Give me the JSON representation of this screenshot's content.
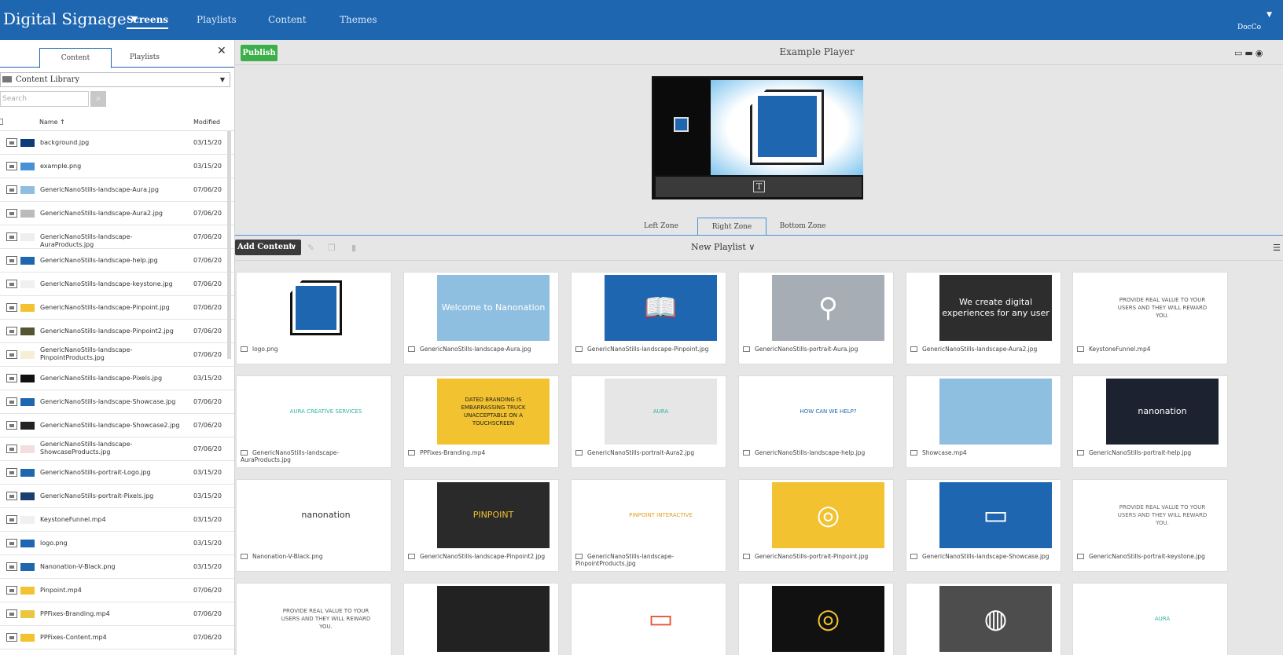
{
  "app": {
    "title": "Digital Signage",
    "user": "DocCo"
  },
  "nav": [
    "Screens",
    "Playlists",
    "Content",
    "Themes"
  ],
  "left": {
    "tabs": [
      "Content",
      "Playlists"
    ],
    "library": "Content Library",
    "search_placeholder": "Search",
    "col_name": "Name ↑",
    "col_modified": "Modified",
    "rows": [
      {
        "name": "background.jpg",
        "date": "03/15/20",
        "color": "#0b3d7a"
      },
      {
        "name": "example.png",
        "date": "03/15/20",
        "color": "#4a90d9"
      },
      {
        "name": "GenericNanoStills-landscape-Aura.jpg",
        "date": "07/06/20",
        "color": "#8fbfe0"
      },
      {
        "name": "GenericNanoStills-landscape-Aura2.jpg",
        "date": "07/06/20",
        "color": "#bbbbbb"
      },
      {
        "name": "GenericNanoStills-landscape-AuraProducts.jpg",
        "date": "07/06/20",
        "color": "#eeeeee"
      },
      {
        "name": "GenericNanoStills-landscape-help.jpg",
        "date": "07/06/20",
        "color": "#1f66b1"
      },
      {
        "name": "GenericNanoStills-landscape-keystone.jpg",
        "date": "07/06/20",
        "color": "#f0f0f0"
      },
      {
        "name": "GenericNanoStills-landscape-Pinpoint.jpg",
        "date": "07/06/20",
        "color": "#f2c230"
      },
      {
        "name": "GenericNanoStills-landscape-Pinpoint2.jpg",
        "date": "07/06/20",
        "color": "#555533"
      },
      {
        "name": "GenericNanoStills-landscape-PinpointProducts.jpg",
        "date": "07/06/20",
        "color": "#f7efd5"
      },
      {
        "name": "GenericNanoStills-landscape-Pixels.jpg",
        "date": "03/15/20",
        "color": "#111111"
      },
      {
        "name": "GenericNanoStills-landscape-Showcase.jpg",
        "date": "07/06/20",
        "color": "#1f66b1"
      },
      {
        "name": "GenericNanoStills-landscape-Showcase2.jpg",
        "date": "07/06/20",
        "color": "#222222"
      },
      {
        "name": "GenericNanoStills-landscape-ShowcaseProducts.jpg",
        "date": "07/06/20",
        "color": "#f3dede"
      },
      {
        "name": "GenericNanoStills-portrait-Logo.jpg",
        "date": "03/15/20",
        "color": "#1f66b1"
      },
      {
        "name": "GenericNanoStills-portrait-Pixels.jpg",
        "date": "03/15/20",
        "color": "#1a3f6f"
      },
      {
        "name": "KeystoneFunnel.mp4",
        "date": "03/15/20",
        "color": "#f0f0f0"
      },
      {
        "name": "logo.png",
        "date": "03/15/20",
        "color": "#1f66b1"
      },
      {
        "name": "Nanonation-V-Black.png",
        "date": "03/15/20",
        "color": "#1f66b1"
      },
      {
        "name": "Pinpoint.mp4",
        "date": "07/06/20",
        "color": "#f2c230"
      },
      {
        "name": "PPFixes-Branding.mp4",
        "date": "07/06/20",
        "color": "#e8c840"
      },
      {
        "name": "PPFixes-Content.mp4",
        "date": "07/06/20",
        "color": "#f2c230"
      }
    ]
  },
  "main": {
    "publish": "Publish",
    "player_title": "Example Player",
    "zones": [
      "Left Zone",
      "Right Zone",
      "Bottom Zone"
    ],
    "add_content": "Add Content",
    "playlist": "New Playlist",
    "cards": [
      {
        "name": "logo.png",
        "kind": "logo"
      },
      {
        "name": "GenericNanoStills-landscape-Aura.jpg",
        "kind": "text",
        "bg": "#8fbfe0",
        "fg": "#ffffff",
        "text": "Welcome to Nanonation"
      },
      {
        "name": "GenericNanoStills-landscape-Pinpoint.jpg",
        "kind": "icon",
        "bg": "#1f66b1",
        "icon": "📖"
      },
      {
        "name": "GenericNanoStills-portrait-Aura.jpg",
        "kind": "icon",
        "bg": "#a6adb4",
        "icon": "⚲"
      },
      {
        "name": "GenericNanoStills-landscape-Aura2.jpg",
        "kind": "text",
        "bg": "#2d2d2d",
        "fg": "#ffffff",
        "text": "We create digital experiences for any user"
      },
      {
        "name": "KeystoneFunnel.mp4",
        "kind": "text",
        "bg": "#ffffff",
        "fg": "#555555",
        "text": "PROVIDE REAL VALUE TO YOUR USERS AND THEY WILL REWARD YOU.",
        "small": true
      },
      {
        "name": "GenericNanoStills-landscape-AuraProducts.jpg",
        "kind": "text",
        "bg": "#ffffff",
        "fg": "#2bb3a3",
        "text": "AURA CREATIVE SERVICES",
        "small": true
      },
      {
        "name": "PPFixes-Branding.mp4",
        "kind": "text",
        "bg": "#f2c230",
        "fg": "#222222",
        "text": "DATED BRANDING IS EMBARRASSING TRUCK UNACCEPTABLE ON A TOUCHSCREEN",
        "small": true
      },
      {
        "name": "GenericNanoStills-portrait-Aura2.jpg",
        "kind": "text",
        "bg": "#e6e6e6",
        "fg": "#2bb3a3",
        "text": "AURA",
        "small": true
      },
      {
        "name": "GenericNanoStills-landscape-help.jpg",
        "kind": "text",
        "bg": "#ffffff",
        "fg": "#1f66b1",
        "text": "HOW CAN WE HELP?",
        "small": true
      },
      {
        "name": "Showcase.mp4",
        "kind": "text",
        "bg": "#8fbfe0",
        "fg": "#8fbfe0",
        "text": ""
      },
      {
        "name": "GenericNanoStills-portrait-help.jpg",
        "kind": "text",
        "bg": "#1c2230",
        "fg": "#ffffff",
        "text": "nanonation"
      },
      {
        "name": "Nanonation-V-Black.png",
        "kind": "text",
        "bg": "#ffffff",
        "fg": "#333333",
        "text": "nanonation"
      },
      {
        "name": "GenericNanoStills-landscape-Pinpoint2.jpg",
        "kind": "text",
        "bg": "#2a2a2a",
        "fg": "#f2c230",
        "text": "PINPOINT"
      },
      {
        "name": "GenericNanoStills-landscape-PinpointProducts.jpg",
        "kind": "text",
        "bg": "#ffffff",
        "fg": "#e0a020",
        "text": "PINPOINT INTERACTIVE",
        "small": true
      },
      {
        "name": "GenericNanoStills-portrait-Pinpoint.jpg",
        "kind": "icon",
        "bg": "#f2c230",
        "icon": "◎"
      },
      {
        "name": "GenericNanoStills-landscape-Showcase.jpg",
        "kind": "icon",
        "bg": "#1f66b1",
        "icon": "▭"
      },
      {
        "name": "GenericNanoStills-portrait-keystone.jpg",
        "kind": "text",
        "bg": "#ffffff",
        "fg": "#666666",
        "text": "PROVIDE REAL VALUE TO YOUR USERS AND THEY WILL REWARD YOU.",
        "small": true
      },
      {
        "name": "",
        "kind": "text",
        "bg": "#ffffff",
        "fg": "#555555",
        "text": "PROVIDE REAL VALUE TO YOUR USERS AND THEY WILL REWARD YOU.",
        "small": true
      },
      {
        "name": "",
        "kind": "text",
        "bg": "#222222",
        "fg": "#222222",
        "text": ""
      },
      {
        "name": "",
        "kind": "icon",
        "bg": "#ffffff",
        "icon": "▭",
        "fgicon": "#e8553a"
      },
      {
        "name": "",
        "kind": "icon",
        "bg": "#111111",
        "icon": "◎",
        "fgicon": "#f2c230"
      },
      {
        "name": "",
        "kind": "icon",
        "bg": "#4d4d4d",
        "icon": "◍"
      },
      {
        "name": "",
        "kind": "text",
        "bg": "#ffffff",
        "fg": "#2bb3a3",
        "text": "AURA",
        "small": true
      }
    ]
  }
}
